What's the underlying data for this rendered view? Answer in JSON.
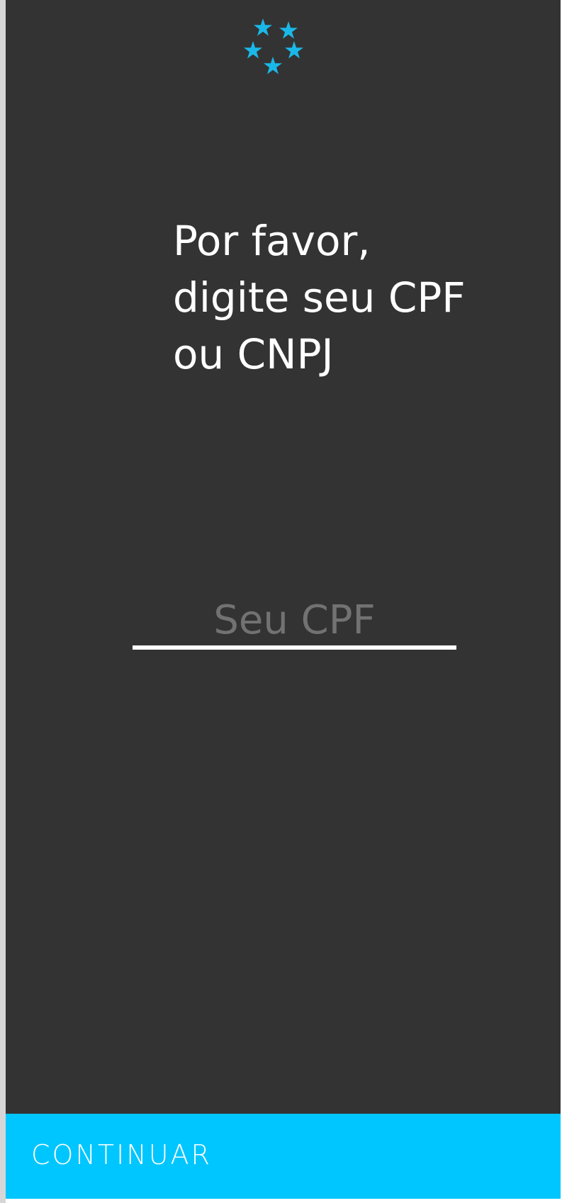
{
  "logo": {
    "icon": "stars-logo-icon",
    "color": "#1ab8e8"
  },
  "prompt": {
    "line1": "Por favor,",
    "line2": "digite seu CPF",
    "line3": "ou CNPJ"
  },
  "cpf_field": {
    "placeholder": "Seu CPF",
    "value": ""
  },
  "actions": {
    "continue_label": "CONTINUAR"
  },
  "colors": {
    "background": "#333333",
    "accent": "#00c6ff",
    "placeholder": "#727272",
    "text": "#ffffff"
  }
}
